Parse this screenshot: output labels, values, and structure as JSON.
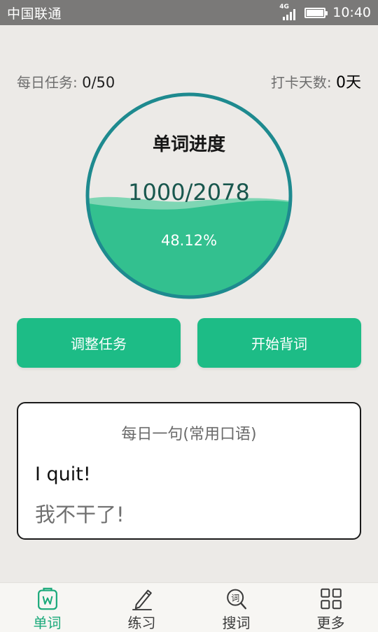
{
  "status_bar": {
    "carrier": "中国联通",
    "network": "4G",
    "time": "10:40"
  },
  "stats": {
    "daily_task_label": "每日任务: ",
    "daily_task_value": "0/50",
    "checkin_label": "打卡天数: ",
    "checkin_value": "0",
    "checkin_unit": "天"
  },
  "progress": {
    "title": "单词进度",
    "count": "1000/2078",
    "percent": "48.12%",
    "fraction": 0.4812
  },
  "actions": {
    "adjust_label": "调整任务",
    "start_label": "开始背词"
  },
  "daily_sentence": {
    "title": "每日一句(常用口语)",
    "english": "I quit!",
    "chinese": "我不干了!"
  },
  "bottom_nav": {
    "items": [
      {
        "label": "单词",
        "icon": "word-book-icon",
        "active": true
      },
      {
        "label": "练习",
        "icon": "pencil-icon",
        "active": false
      },
      {
        "label": "搜词",
        "icon": "search-word-icon",
        "active": false
      },
      {
        "label": "更多",
        "icon": "grid-icon",
        "active": false
      }
    ]
  },
  "colors": {
    "accent": "#1dbc86",
    "ring": "#1e8a8f",
    "wave": "#33c08f",
    "status_bar": "#7a7978",
    "background": "#eceae7"
  }
}
